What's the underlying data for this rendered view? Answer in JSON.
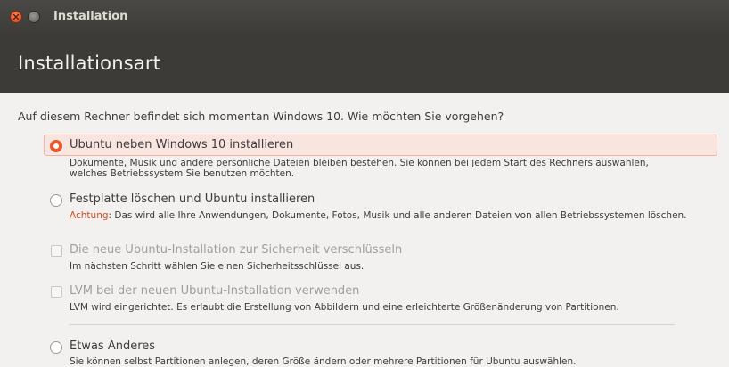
{
  "window": {
    "title": "Installation"
  },
  "header": {
    "title": "Installationsart"
  },
  "question": "Auf diesem Rechner befindet sich momentan Windows 10. Wie möchten Sie vorgehen?",
  "options": [
    {
      "label": "Ubuntu neben Windows 10 installieren",
      "desc_line1": "Dokumente, Musik und andere persönliche Dateien bleiben bestehen. Sie können bei jedem Start des Rechners auswählen,",
      "desc_line2": "welches Betriebssystem Sie benutzen möchten.",
      "selected": true
    },
    {
      "label": "Festplatte löschen und Ubuntu installieren",
      "warning_prefix": "Achtung",
      "desc": ": Das wird alle Ihre Anwendungen, Dokumente, Fotos, Musik und alle anderen Dateien von allen Betriebssystemen löschen.",
      "selected": false
    }
  ],
  "checkboxes": [
    {
      "label": "Die neue Ubuntu-Installation zur Sicherheit verschlüsseln",
      "desc": "Im nächsten Schritt wählen Sie einen Sicherheitsschlüssel aus.",
      "checked": false,
      "enabled": false
    },
    {
      "label": "LVM bei der neuen Ubuntu-Installation verwenden",
      "desc": "LVM wird eingerichtet. Es erlaubt die Erstellung von Abbildern und eine erleichterte Größenänderung von Partitionen.",
      "checked": false,
      "enabled": false
    }
  ],
  "other_option": {
    "label": "Etwas Anderes",
    "desc": "Sie können selbst Partitionen anlegen, deren Größe ändern oder mehrere Partitionen für Ubuntu auswählen.",
    "selected": false
  },
  "colors": {
    "accent": "#e8592b",
    "warning": "#d44a1b",
    "header_bg": "#3c3b37"
  }
}
